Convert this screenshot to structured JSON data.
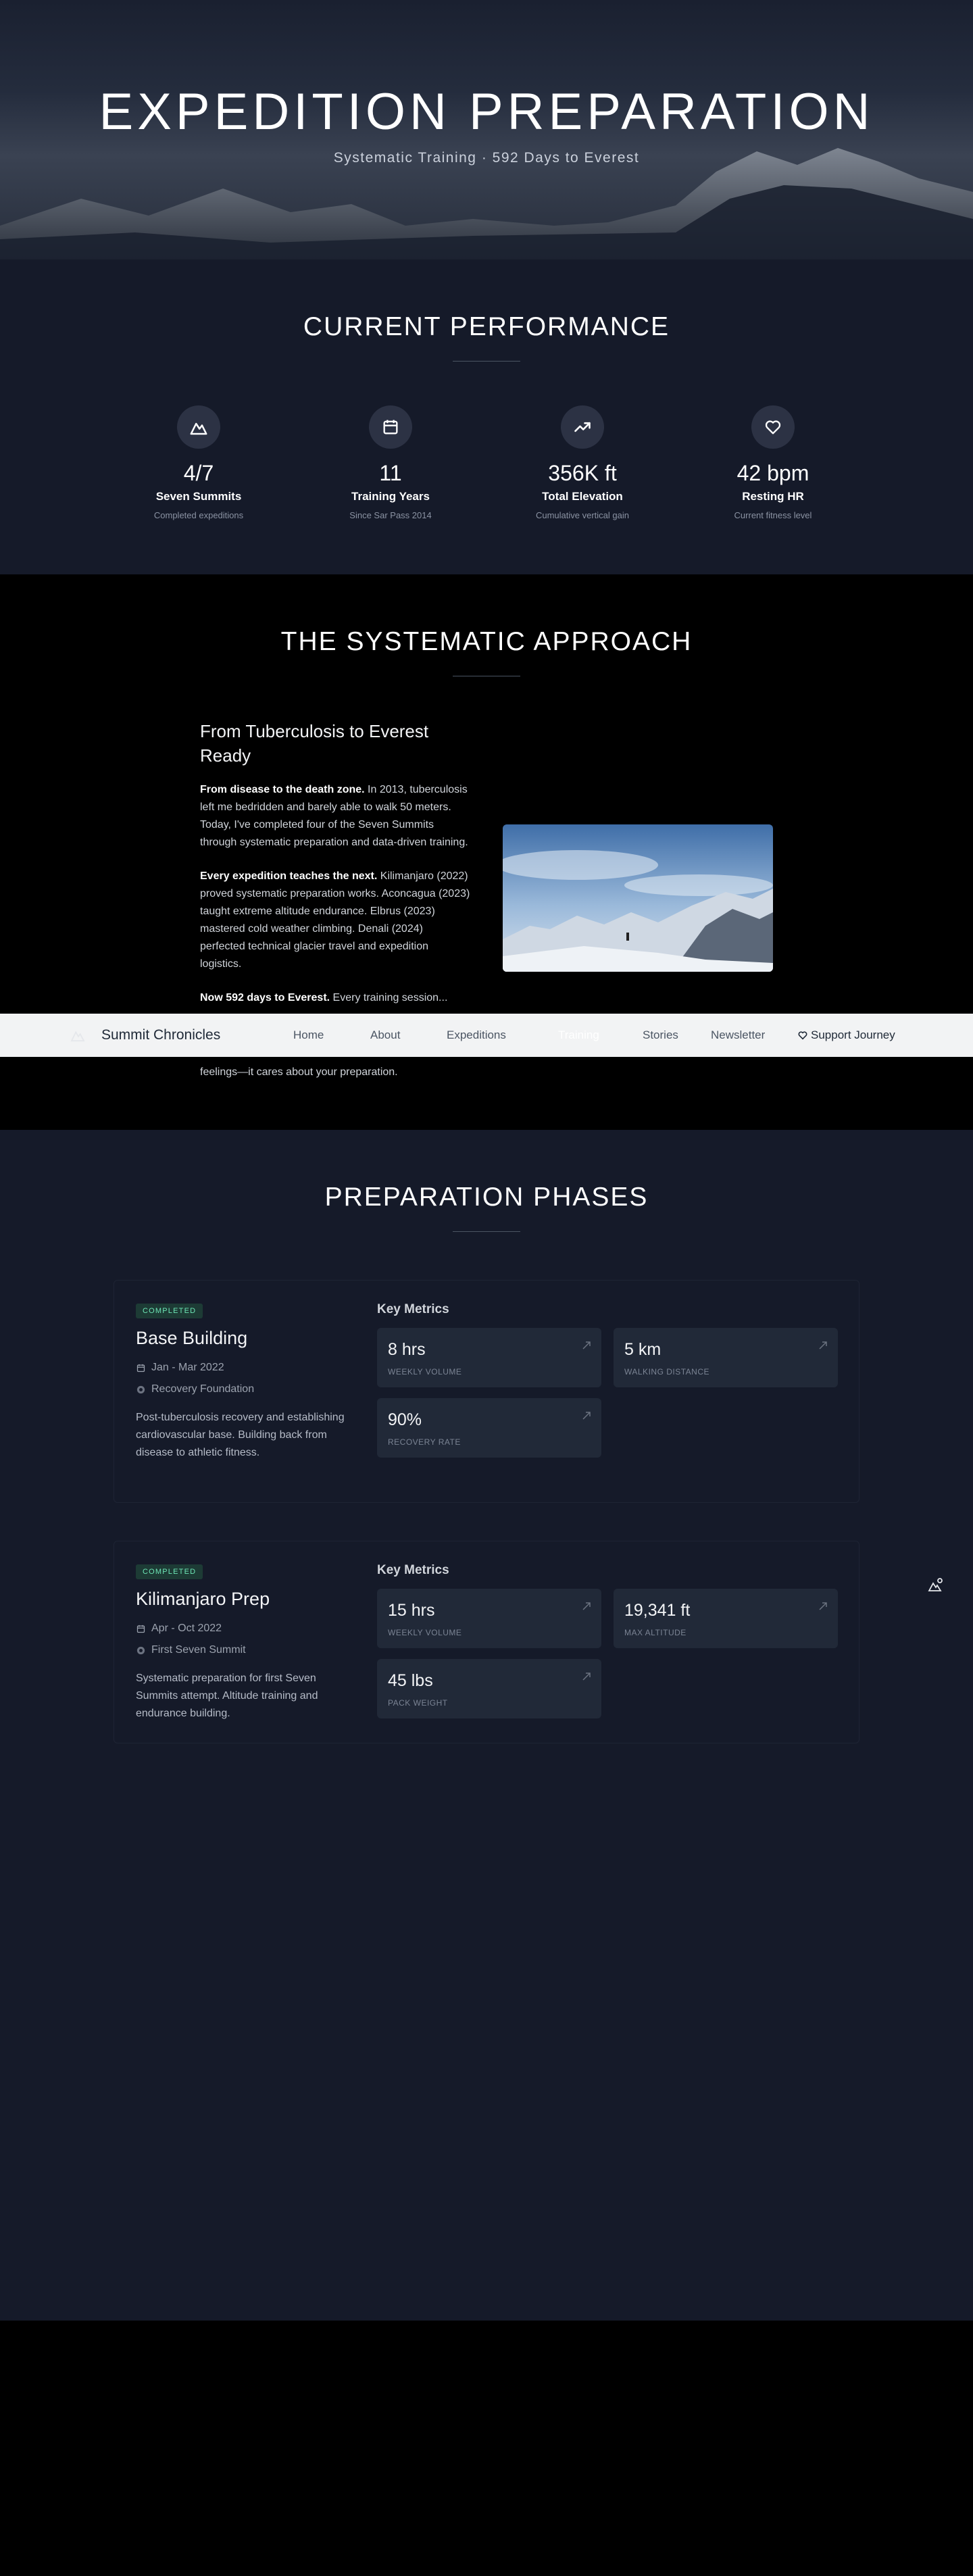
{
  "hero": {
    "title": "EXPEDITION PREPARATION",
    "subtitle": "Systematic Training · 592 Days to Everest"
  },
  "performance": {
    "heading": "CURRENT PERFORMANCE",
    "stats": [
      {
        "icon": "mountain-icon",
        "value": "4/7",
        "label": "Seven Summits",
        "sub": "Completed expeditions"
      },
      {
        "icon": "calendar-icon",
        "value": "11",
        "label": "Training Years",
        "sub": "Since Sar Pass 2014"
      },
      {
        "icon": "trending-up-icon",
        "value": "356K ft",
        "label": "Total Elevation",
        "sub": "Cumulative vertical gain"
      },
      {
        "icon": "heart-icon",
        "value": "42 bpm",
        "label": "Resting HR",
        "sub": "Current fitness level"
      }
    ]
  },
  "approach": {
    "heading": "THE SYSTEMATIC APPROACH",
    "subheading": "From Tuberculosis to Everest Ready",
    "paragraphs": [
      {
        "lead": "From disease to the death zone.",
        "text": " In 2013, tuberculosis left me bedridden and barely able to walk 50 meters. Today, I've completed four of the Seven Summits through systematic preparation and data-driven training."
      },
      {
        "lead": "Every expedition teaches the next.",
        "text": " Kilimanjaro (2022) proved systematic preparation works. Aconcagua (2023) taught extreme altitude endurance. Elbrus (2023) mastered cold weather climbing. Denali (2024) perfected technical glacier travel and expedition logistics."
      },
      {
        "lead": "Now 592 days to Everest.",
        "text": " Every training session..."
      }
    ],
    "trailing_line": "feelings—it cares about your preparation."
  },
  "nav": {
    "brand": "Summit Chronicles",
    "links": [
      "Home",
      "About",
      "Expeditions",
      "Training",
      "Stories",
      "Newsletter"
    ],
    "cta": "Support Journey"
  },
  "phases": {
    "heading": "PREPARATION PHASES",
    "items": [
      {
        "status": "COMPLETED",
        "title": "Base Building",
        "dates": "Jan - Mar 2022",
        "focus": "Recovery Foundation",
        "description": "Post-tuberculosis recovery and establishing cardiovascular base. Building back from disease to athletic fitness.",
        "metrics_heading": "Key Metrics",
        "metrics": [
          {
            "value": "8 hrs",
            "label": "WEEKLY VOLUME"
          },
          {
            "value": "5 km",
            "label": "WALKING DISTANCE"
          },
          {
            "value": "90%",
            "label": "RECOVERY RATE"
          }
        ]
      },
      {
        "status": "COMPLETED",
        "title": "Kilimanjaro Prep",
        "dates": "Apr - Oct 2022",
        "focus": "First Seven Summit",
        "description": "Systematic preparation for first Seven Summits attempt. Altitude training and endurance building.",
        "metrics_heading": "Key Metrics",
        "metrics": [
          {
            "value": "15 hrs",
            "label": "WEEKLY VOLUME"
          },
          {
            "value": "19,341 ft",
            "label": "MAX ALTITUDE"
          },
          {
            "value": "45 lbs",
            "label": "PACK WEIGHT"
          }
        ]
      }
    ]
  },
  "colors": {
    "page_dark": "#151a29",
    "approach_bg": "#000000",
    "badge_bg": "#1d3b35",
    "badge_text": "#6ee7b7",
    "metric_tile": "#212938"
  }
}
